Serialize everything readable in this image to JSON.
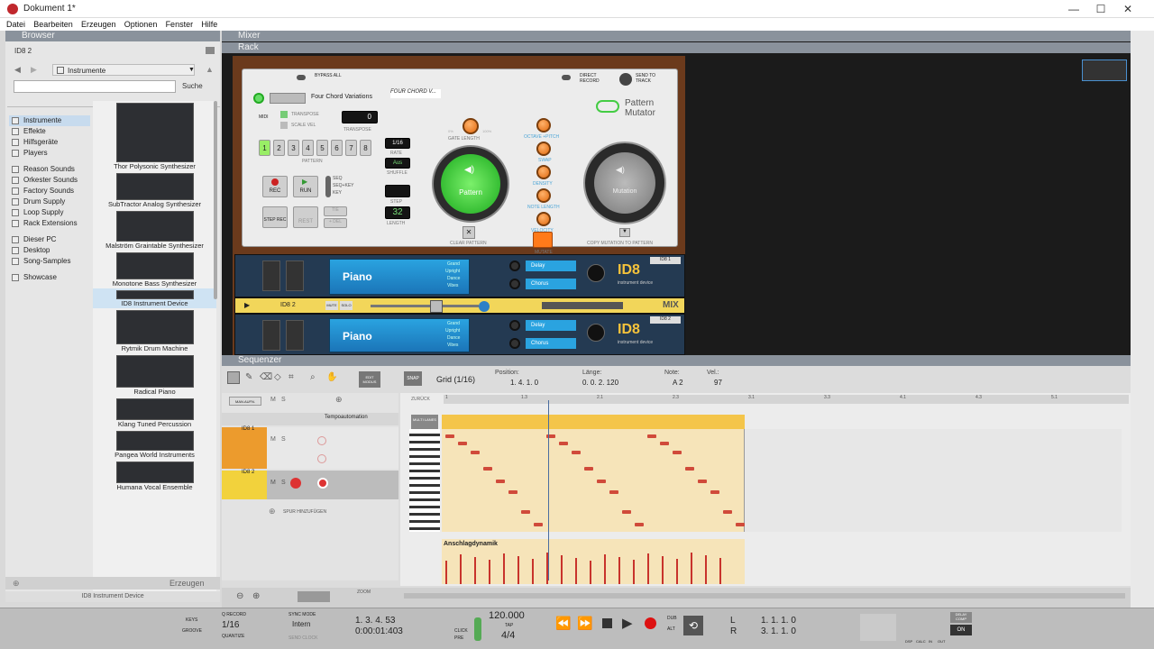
{
  "window": {
    "title": "Dokument 1*",
    "min": "—",
    "max": "☐",
    "close": "✕"
  },
  "menu": [
    "Datei",
    "Bearbeiten",
    "Erzeugen",
    "Optionen",
    "Fenster",
    "Hilfe"
  ],
  "browser": {
    "panel_title": "Browser",
    "location_label": "ID8 2",
    "folder": "Instrumente",
    "search_placeholder": "",
    "search_button": "Suche",
    "locations": [
      {
        "label": "Instrumente",
        "selected": true
      },
      {
        "label": "Effekte"
      },
      {
        "label": "Hilfsgeräte"
      },
      {
        "label": "Players"
      },
      {
        "label": "Reason Sounds"
      },
      {
        "label": "Orkester Sounds"
      },
      {
        "label": "Factory Sounds"
      },
      {
        "label": "Drum Supply"
      },
      {
        "label": "Loop Supply"
      },
      {
        "label": "Rack Extensions"
      },
      {
        "label": "Dieser PC"
      },
      {
        "label": "Desktop"
      },
      {
        "label": "Song-Samples"
      },
      {
        "label": "Showcase"
      }
    ],
    "devices": [
      {
        "label": "Thor Polysonic Synthesizer"
      },
      {
        "label": "SubTractor Analog Synthesizer"
      },
      {
        "label": "Malström Graintable Synthesizer"
      },
      {
        "label": "Monotone Bass Synthesizer"
      },
      {
        "label": "ID8 Instrument Device",
        "selected": true
      },
      {
        "label": "Rytmik Drum Machine"
      },
      {
        "label": "Radical Piano"
      },
      {
        "label": "Klang Tuned Percussion"
      },
      {
        "label": "Pangea World Instruments"
      },
      {
        "label": "Humana Vocal Ensemble"
      }
    ],
    "create_button": "Erzeugen",
    "status": "ID8 Instrument Device"
  },
  "mixer_title": "Mixer",
  "rack_title": "Rack",
  "pattern_mutator": {
    "bypass": "BYPASS ALL",
    "direct_record": "DIRECT RECORD",
    "send_to_track": "SEND TO TRACK",
    "patch_name": "Four Chord Variations",
    "handwritten": "FOUR CHORD V...",
    "on": "ON",
    "midi": "MIDI",
    "transpose": "TRANSPOSE",
    "scale_vel": "SCALE VEL",
    "transpose_value": "0",
    "pattern_label": "PATTERN",
    "pattern_buttons": [
      "1",
      "2",
      "3",
      "4",
      "5",
      "6",
      "7",
      "8"
    ],
    "rate_value": "1/16",
    "rate": "RATE",
    "shuffle_value": "Aus",
    "shuffle": "SHUFFLE",
    "step": "STEP",
    "length_value": "32",
    "length": "LENGTH",
    "rec": "REC",
    "run": "RUN",
    "seq": "SEQ",
    "seq_key": "SEQ+KEY",
    "key": "KEY",
    "step_rec": "STEP REC",
    "rest": "REST",
    "tie": "TIE",
    "del": "+ DEL",
    "gate_length": "GATE LENGTH",
    "min_pct": "0%",
    "max_pct": "100%",
    "pattern_big": "Pattern",
    "clear_pattern": "CLEAR PATTERN",
    "octave_pitch": "OCTAVE  +PITCH",
    "swap": "SWAP",
    "density": "DENSITY",
    "note_length": "NOTE LENGTH",
    "velocity": "VELOCITY",
    "mutate": "MUTATE",
    "mutation": "Mutation",
    "copy_mutation": "COPY MUTATION TO PATTERN",
    "logo_line1": "Pattern",
    "logo_line2": "Mutator",
    "mix": "MIX"
  },
  "id8_devices": [
    {
      "patch": "Piano",
      "categories": [
        "Grand",
        "Upright",
        "Dance",
        "Vibes"
      ],
      "delay": "Delay",
      "chorus": "Chorus",
      "logo": "ID8",
      "sub": "instrument device",
      "name": "ID8 1"
    },
    {
      "patch": "Piano",
      "categories": [
        "Grand",
        "Upright",
        "Dance",
        "Vibes"
      ],
      "delay": "Delay",
      "chorus": "Chorus",
      "logo": "ID8",
      "sub": "instrument device",
      "name": "ID8 2"
    }
  ],
  "mixstrip": {
    "name": "ID8 2",
    "mute": "MUTE",
    "solo": "SOLO",
    "mix": "MIX"
  },
  "sequencer": {
    "panel_title": "Sequenzer",
    "edit_mode": "EDIT MODUS",
    "snap": "SNAP",
    "grid": "Grid (1/16)",
    "position_label": "Position:",
    "position_value": "1.  4.  1.    0",
    "length_label": "Länge:",
    "length_value": "0.  0.  2. 120",
    "note_label": "Note:",
    "note_value": "A 2",
    "vel_label": "Vel.:",
    "vel_value": "97",
    "man_aufn": "MAN.AUFN.",
    "m": "M",
    "s": "S",
    "back": "ZURÜCK",
    "tempo": "Tempoautomation",
    "track1": "ID8 1",
    "track2": "ID8 2",
    "add_track": "SPUR HINZUFÜGEN",
    "multi_lanes": "MULTI LANES",
    "ruler": [
      "1",
      "1.3",
      "2.1",
      "2.3",
      "3.1",
      "3.3",
      "4.1",
      "4.3",
      "5.1"
    ],
    "velocity_lane": "Anschlagdynamik",
    "zoom": "ZOOM"
  },
  "transport": {
    "keys": "KEYS",
    "groove": "GROOVE",
    "quantize_rec": "Q RECORD",
    "quantize_value": "1/16",
    "quantize": "QUANTIZE",
    "sync_mode": "SYNC MODE",
    "sync_value": "Intern",
    "send_clock": "SEND CLOCK",
    "position": "1.  3.  4.  53",
    "time": "0:00:01:403",
    "click": "CLICK",
    "pre": "PRE",
    "tempo": "120.000",
    "tap": "TAP",
    "signature": "4/4",
    "dub": "DUB",
    "alt": "ALT",
    "loop_l": "L",
    "loop_r": "R",
    "l_value": "1.  1.  1.    0",
    "r_value": "3.  1.  1.    0",
    "delay_comp": "DELAY COMP",
    "on": "ON",
    "dsp": "DSP",
    "calc": "CALC",
    "in": "IN",
    "out": "OUT"
  }
}
